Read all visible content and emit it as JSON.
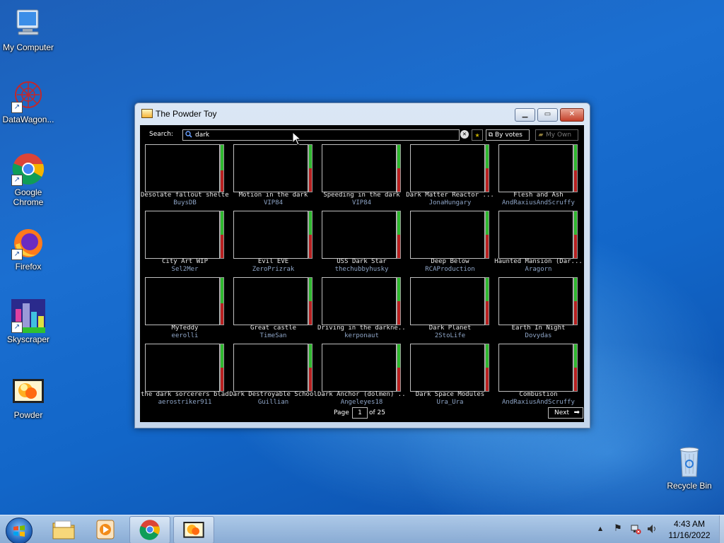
{
  "desktop": {
    "icons": [
      {
        "label": "My Computer"
      },
      {
        "label": "DataWagon..."
      },
      {
        "label": "Google Chrome"
      },
      {
        "label": "Firefox"
      },
      {
        "label": "Skyscraper"
      },
      {
        "label": "Powder"
      },
      {
        "label": "Recycle Bin"
      }
    ]
  },
  "window": {
    "title": "The Powder Toy",
    "controls": {
      "minimize": "▁",
      "maximize": "▭",
      "close": "✕"
    }
  },
  "app": {
    "search": {
      "label": "Search:",
      "value": "dark"
    },
    "sort_label": "By votes",
    "myown_label": "My Own",
    "saves": [
      {
        "name": "Desolate fallout shelter",
        "author": "BuysDB",
        "votes_up": 0.55
      },
      {
        "name": "Motion in the dark",
        "author": "VIP84",
        "votes_up": 0.5
      },
      {
        "name": "Speeding in the dark",
        "author": "VIP84",
        "votes_up": 0.5
      },
      {
        "name": "Dark Matter Reactor ...",
        "author": "JonaHungary",
        "votes_up": 0.5
      },
      {
        "name": "Flesh and Ash",
        "author": "AndRaxiusAndScruffy",
        "votes_up": 0.55
      },
      {
        "name": "City Art WIP",
        "author": "Sel2Mer",
        "votes_up": 0.5
      },
      {
        "name": "Evil EVE",
        "author": "ZeroPrizrak",
        "votes_up": 0.5
      },
      {
        "name": "USS Dark Star",
        "author": "thechubbyhusky",
        "votes_up": 0.5
      },
      {
        "name": "Deep Below",
        "author": "RCAProduction",
        "votes_up": 0.5
      },
      {
        "name": "Haunted Mansion (Dar...",
        "author": "Aragorn",
        "votes_up": 0.5
      },
      {
        "name": "MyTeddy",
        "author": "eerolli",
        "votes_up": 0.55
      },
      {
        "name": "Great castle",
        "author": "TimeSan",
        "votes_up": 0.5
      },
      {
        "name": "Driving in the darkne...",
        "author": "kerponaut",
        "votes_up": 0.5
      },
      {
        "name": "Dark Planet",
        "author": "2StoLife",
        "votes_up": 0.5
      },
      {
        "name": "Earth In Night",
        "author": "Dovydas",
        "votes_up": 0.5
      },
      {
        "name": "the dark sorcerers blade",
        "author": "aerostriker911",
        "votes_up": 0.5
      },
      {
        "name": "Dark Destroyable School",
        "author": "Guillian",
        "votes_up": 0.5
      },
      {
        "name": "Dark Anchor (dolmen) ...",
        "author": "Angeleyes18",
        "votes_up": 0.5
      },
      {
        "name": "Dark Space Modules",
        "author": "Ura_Ura",
        "votes_up": 0.5
      },
      {
        "name": "Combustion",
        "author": "AndRaxiusAndScruffy",
        "votes_up": 0.5
      }
    ],
    "pagination": {
      "page_label": "Page",
      "current": "1",
      "of_label": "of 25",
      "next_label": "Next"
    }
  },
  "taskbar": {
    "clock": {
      "time": "4:43 AM",
      "date": "11/16/2022"
    }
  },
  "colors": {
    "vote_up": "#2fb82f",
    "vote_down": "#b82020",
    "author": "#8fa6c8"
  }
}
